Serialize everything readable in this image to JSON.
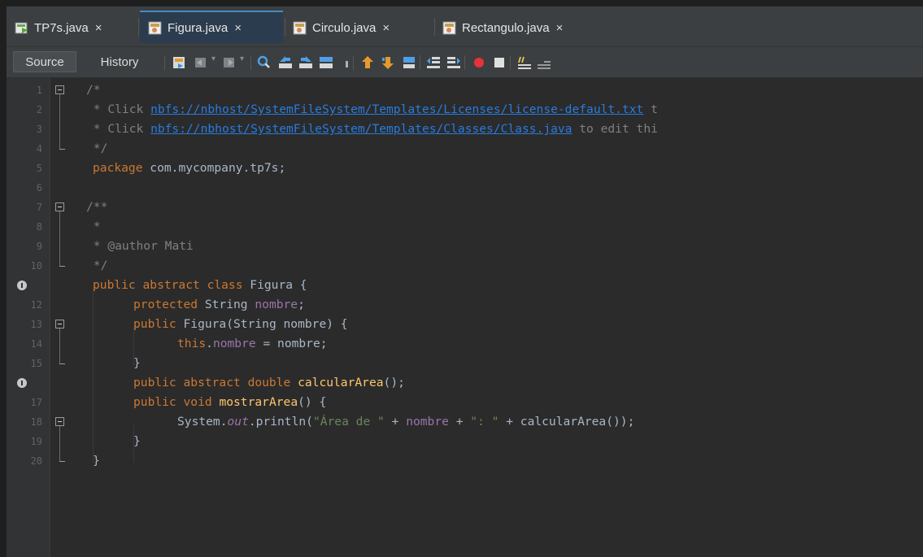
{
  "tabs": [
    {
      "label": "TP7s.java",
      "close": "×",
      "active": false
    },
    {
      "label": "Figura.java",
      "close": "×",
      "active": true
    },
    {
      "label": "Circulo.java",
      "close": "×",
      "active": false
    },
    {
      "label": "Rectangulo.java",
      "close": "×",
      "active": false
    }
  ],
  "toolbar": {
    "source": "Source",
    "history": "History"
  },
  "code": {
    "l1_a": "/*",
    "l2_a": " * Click ",
    "l2_link": "nbfs://nbhost/SystemFileSystem/Templates/Licenses/license-default.txt",
    "l2_b": " t",
    "l3_a": " * Click ",
    "l3_link": "nbfs://nbhost/SystemFileSystem/Templates/Classes/Class.java",
    "l3_b": " to edit thi",
    "l4_a": " */",
    "l5_kw": "package",
    "l5_b": " com.mycompany.tp7s;",
    "l7_a": "/**",
    "l8_a": " *",
    "l9_a": " * ",
    "l9_ann": "@author",
    "l9_b": " Mati",
    "l10_a": " */",
    "l11_kw": "public abstract class",
    "l11_b": " Figura {",
    "l12_kw": "protected",
    "l12_b": " String ",
    "l12_fld": "nombre",
    "l12_c": ";",
    "l13_kw": "public",
    "l13_b": " Figura(String nombre) {",
    "l14_kw": "this",
    "l14_dot": ".",
    "l14_fld": "nombre",
    "l14_b": " = nombre;",
    "l15_a": "}",
    "l16_kw": "public abstract double",
    "l16_b": " ",
    "l16_m": "calcularArea",
    "l16_c": "();",
    "l17_kw": "public void",
    "l17_b": " ",
    "l17_m": "mostrarArea",
    "l17_c": "() {",
    "l18_a": "System.",
    "l18_stat": "out",
    "l18_b": ".println(",
    "l18_s1": "\"Área de \"",
    "l18_c": " + ",
    "l18_fld": "nombre",
    "l18_d": " + ",
    "l18_s2": "\": \"",
    "l18_e": " + calcularArea());",
    "l19_a": "}",
    "l20_a": "}"
  },
  "line_numbers": [
    "1",
    "2",
    "3",
    "4",
    "5",
    "6",
    "7",
    "8",
    "9",
    "10",
    "",
    "12",
    "13",
    "14",
    "15",
    "",
    "17",
    "18",
    "19",
    "20"
  ],
  "colors": {
    "keyword": "#cc7832",
    "comment": "#808080",
    "link": "#287bde",
    "field": "#9876aa",
    "string": "#6a8759",
    "method": "#ffc66d",
    "text": "#a9b7c6"
  }
}
